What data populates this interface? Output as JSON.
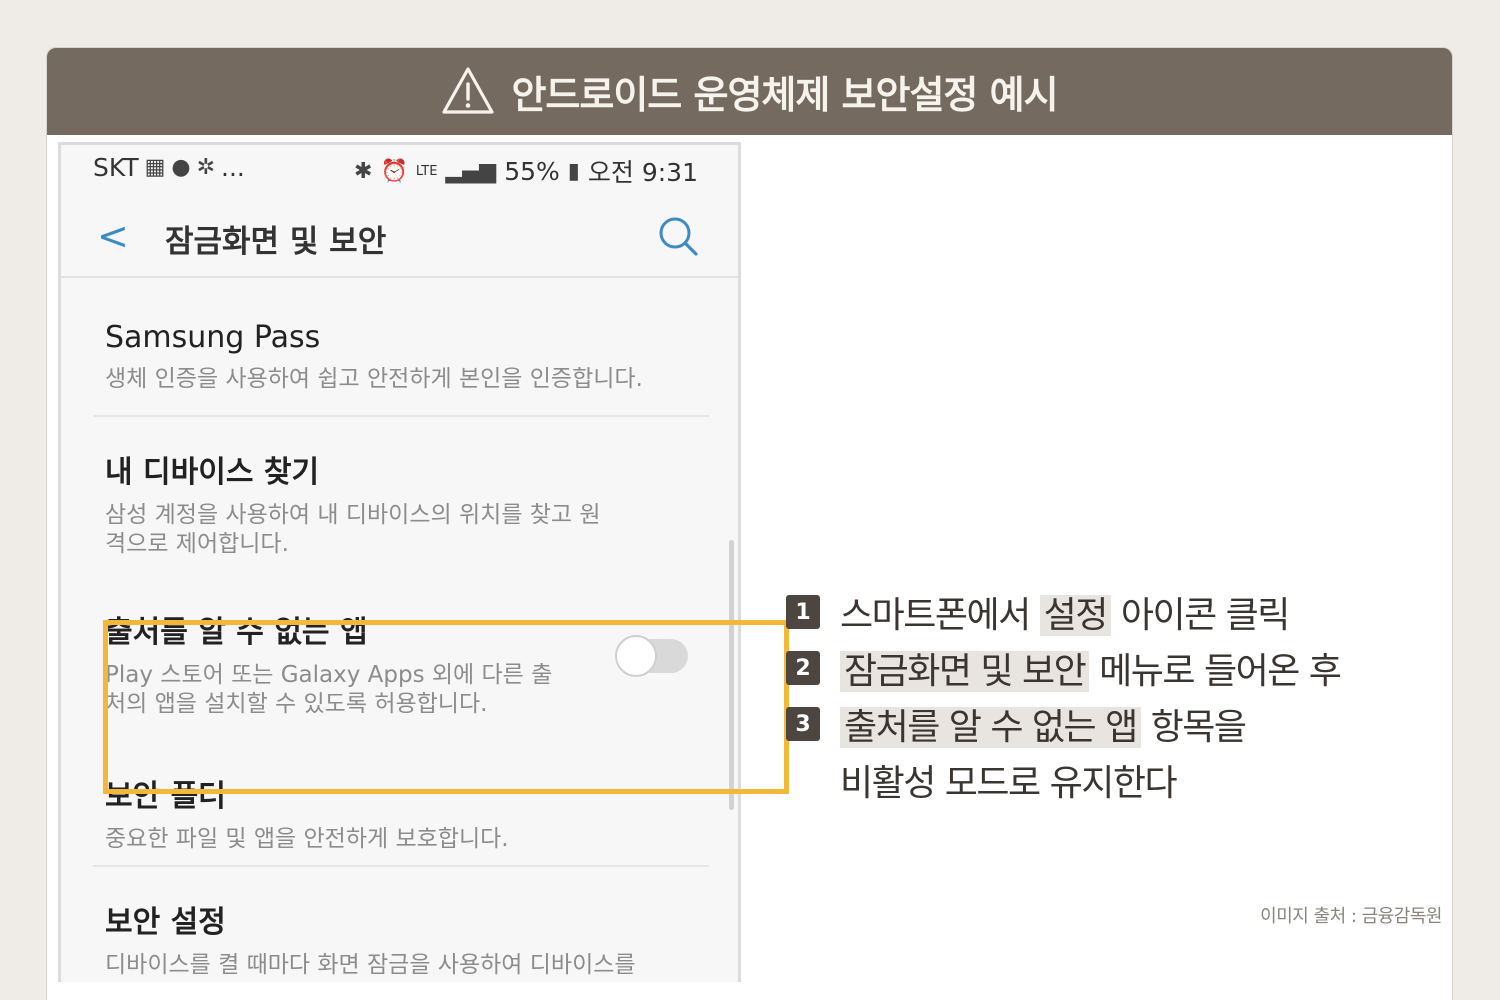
{
  "banner": {
    "title": "안드로이드 운영체제 보안설정 예시"
  },
  "phone": {
    "status_left": "SKT",
    "status_dots": "...",
    "status_signal": "LTE",
    "status_battery": "55%",
    "status_time": "오전 9:31",
    "page_title": "잠금화면 및 보안",
    "items": [
      {
        "title": "Samsung Pass",
        "subtitle": "생체 인증을 사용하여 쉽고 안전하게 본인을 인증합니다."
      },
      {
        "title": "내 디바이스 찾기",
        "subtitle": "삼성 계정을 사용하여 내 디바이스의 위치를 찾고 원격으로 제어합니다."
      },
      {
        "title": "출처를 알 수 없는 앱",
        "subtitle": "Play 스토어 또는 Galaxy Apps 외에 다른 출처의 앱을 설치할 수 있도록 허용합니다.",
        "toggle_on": false
      },
      {
        "title": "보안 폴더",
        "subtitle": "중요한 파일 및 앱을 안전하게 보호합니다."
      },
      {
        "title": "보안 설정",
        "subtitle": "디바이스를 켤 때마다 화면 잠금을 사용하여 디바이스를"
      }
    ]
  },
  "steps": [
    {
      "num": "1",
      "pre": "스마트폰에서 ",
      "mark": "설정",
      "post": " 아이콘 클릭"
    },
    {
      "num": "2",
      "pre": "",
      "mark": "잠금화면 및 보안",
      "post": " 메뉴로 들어온 후"
    },
    {
      "num": "3",
      "pre": "",
      "mark": "출처를 알 수 없는 앱",
      "post": " 항목을"
    },
    {
      "continuation": "비활성 모드로 유지한다"
    }
  ],
  "credit": "이미지 출처 : 금융감독원",
  "colors": {
    "banner": "#756a5f",
    "highlight": "#f3b73a",
    "accent": "#3d8bc4",
    "step_badge": "#4c4540"
  }
}
